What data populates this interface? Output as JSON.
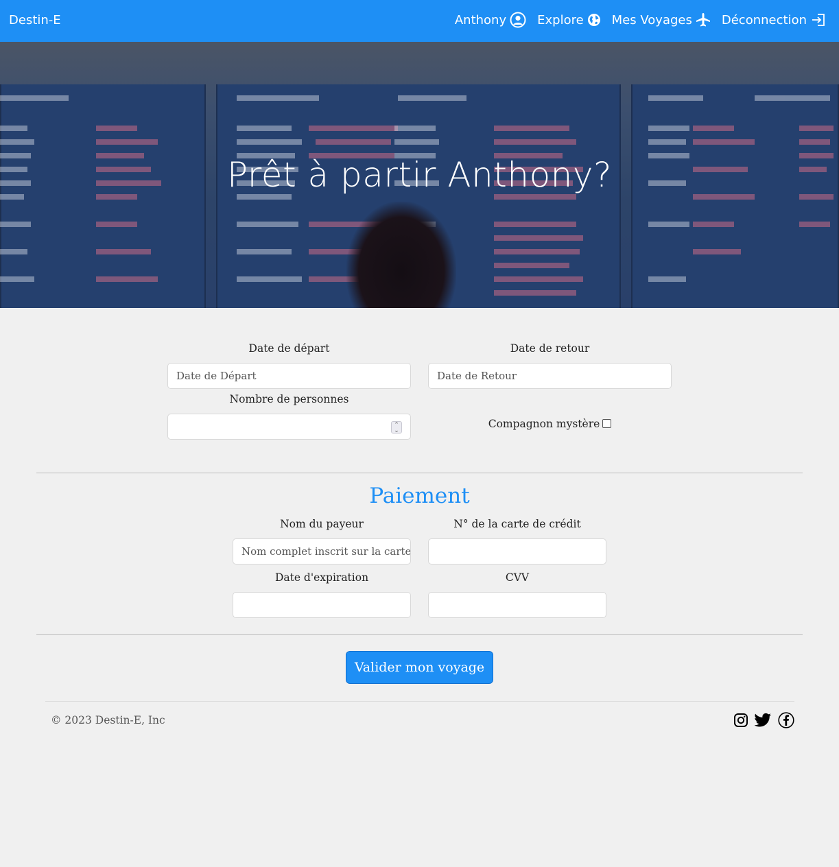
{
  "navbar": {
    "brand": "Destin-E",
    "items": [
      {
        "label": "Anthony",
        "icon": "user-circle-icon"
      },
      {
        "label": "Explore",
        "icon": "globe-icon"
      },
      {
        "label": "Mes Voyages",
        "icon": "airplane-icon"
      },
      {
        "label": "Déconnection",
        "icon": "logout-icon"
      }
    ]
  },
  "hero": {
    "title": "Prêt à partir Anthony?"
  },
  "trip": {
    "depart_label": "Date de départ",
    "depart_placeholder": "Date de Départ",
    "return_label": "Date de retour",
    "return_placeholder": "Date de Retour",
    "people_label": "Nombre de personnes",
    "people_value": "",
    "mystery_label": "Compagnon mystère",
    "mystery_checked": false
  },
  "payment": {
    "title": "Paiement",
    "payer_label": "Nom du payeur",
    "payer_placeholder": "Nom complet inscrit sur la carte",
    "card_label": "N° de la carte de crédit",
    "card_value": "",
    "expiry_label": "Date d'expiration",
    "expiry_value": "",
    "cvv_label": "CVV",
    "cvv_value": ""
  },
  "submit_label": "Valider mon voyage",
  "footer": {
    "copyright": "© 2023 Destin-E, Inc",
    "socials": [
      "instagram-icon",
      "twitter-icon",
      "facebook-icon"
    ]
  },
  "colors": {
    "accent": "#1e8ff5",
    "background": "#f0f0f0"
  }
}
